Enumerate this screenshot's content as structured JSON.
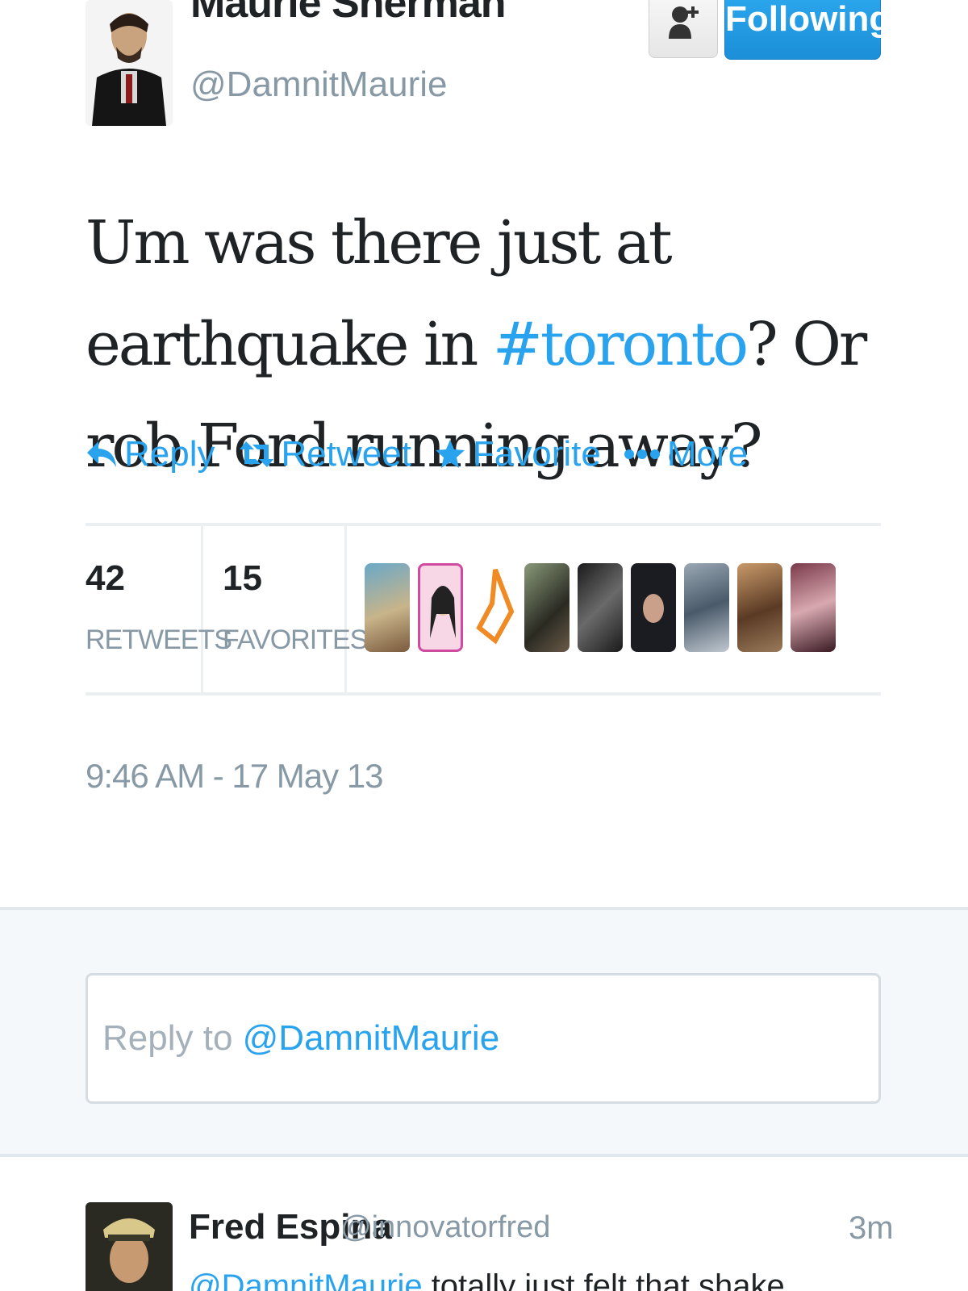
{
  "tweet": {
    "author_name": "Maurie Sherman",
    "author_handle": "@DamnitMaurie",
    "follow_label": "Following",
    "text_before": "Um was there just at earthquake in ",
    "hashtag": "#toronto",
    "text_after": "? Or rob Ford running away?",
    "timestamp": "9:46 AM - 17 May 13"
  },
  "actions": [
    {
      "label": "Reply",
      "icon": "reply-icon"
    },
    {
      "label": "Retweet",
      "icon": "retweet-icon"
    },
    {
      "label": "Favorite",
      "icon": "star-icon"
    },
    {
      "label": "More",
      "icon": "more-dots-icon"
    }
  ],
  "stats": {
    "retweets_count": "42",
    "retweets_label": "RETWEETS",
    "favorites_count": "15",
    "favorites_label": "FAVORITES"
  },
  "reply_box": {
    "prefix": "Reply to ",
    "mention": "@DamnitMaurie"
  },
  "replies": [
    {
      "name": "Fred Espina",
      "handle": "@innovatorfred",
      "time": "3m",
      "snippet_mention": "@DamnitMaurie",
      "snippet_text": " totally just felt that shake"
    }
  ],
  "colors": {
    "link_blue": "#2aa3ef",
    "button_blue": "#1b8fd8",
    "muted_gray": "#8899a6"
  }
}
